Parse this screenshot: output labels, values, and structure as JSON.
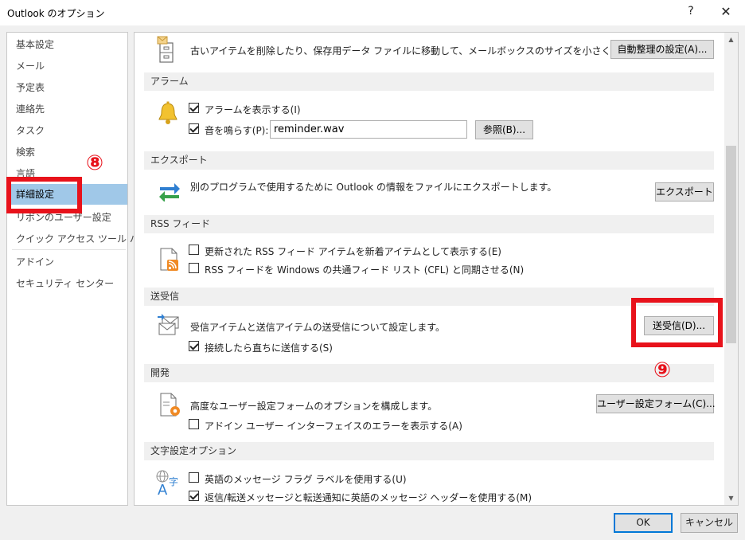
{
  "window": {
    "title": "Outlook のオプション",
    "help": "?",
    "close": "✕"
  },
  "nav": {
    "items": [
      "基本設定",
      "メール",
      "予定表",
      "連絡先",
      "タスク",
      "検索",
      "言語",
      "詳細設定",
      "リボンのユーザー設定",
      "クイック アクセス ツール バー",
      "アドイン",
      "セキュリティ センター"
    ],
    "selected": "詳細設定"
  },
  "autoarchive": {
    "text": "古いアイテムを削除したり、保存用データ ファイルに移動して、メールボックスのサイズを小さくします。",
    "button": "自動整理の設定(A)..."
  },
  "alarm": {
    "header": "アラーム",
    "show_alarm": "アラームを表示する(I)",
    "show_alarm_checked": true,
    "play_sound": "音を鳴らす(P):",
    "play_sound_checked": true,
    "sound_file": "reminder.wav",
    "browse": "参照(B)..."
  },
  "export": {
    "header": "エクスポート",
    "text": "別のプログラムで使用するために Outlook の情報をファイルにエクスポートします。",
    "button": "エクスポート"
  },
  "rss": {
    "header": "RSS フィード",
    "item1": "更新された RSS フィード アイテムを新着アイテムとして表示する(E)",
    "item1_checked": false,
    "item2": "RSS フィードを Windows の共通フィード リスト (CFL) と同期させる(N)",
    "item2_checked": false
  },
  "sendreceive": {
    "header": "送受信",
    "text": "受信アイテムと送信アイテムの送受信について設定します。",
    "button": "送受信(D)...",
    "send_immediately": "接続したら直ちに送信する(S)",
    "send_immediately_checked": true
  },
  "developer": {
    "header": "開発",
    "text": "高度なユーザー設定フォームのオプションを構成します。",
    "button": "ユーザー設定フォーム(C)...",
    "addin_errors": "アドイン ユーザー インターフェイスのエラーを表示する(A)",
    "addin_errors_checked": false
  },
  "international": {
    "header": "文字設定オプション",
    "item1": "英語のメッセージ フラグ ラベルを使用する(U)",
    "item1_checked": false,
    "item2": "返信/転送メッセージと転送通知に英語のメッセージ ヘッダーを使用する(M)",
    "item2_checked": true
  },
  "footer": {
    "ok": "OK",
    "cancel": "キャンセル"
  },
  "annotations": {
    "step8": "⑧",
    "step9": "⑨",
    "color": "#e8121b"
  },
  "colors": {
    "selected_nav": "#a0c8e8",
    "dialog_bg": "#f0f0f0",
    "section_header_bg": "#f0f0f0"
  }
}
